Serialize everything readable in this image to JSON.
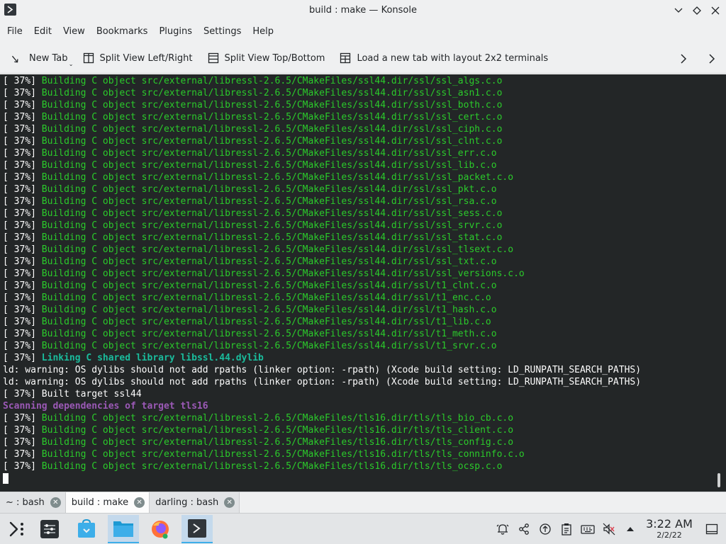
{
  "window": {
    "title": "build : make — Konsole"
  },
  "menu": [
    "File",
    "Edit",
    "View",
    "Bookmarks",
    "Plugins",
    "Settings",
    "Help"
  ],
  "toolbar": {
    "new_tab": "New Tab",
    "split_lr": "Split View Left/Right",
    "split_tb": "Split View Top/Bottom",
    "layout": "Load a new tab with layout 2x2 terminals"
  },
  "terminal": {
    "lines": [
      {
        "pct": "[ 37%]",
        "text": "Building C object src/external/libressl-2.6.5/CMakeFiles/ssl44.dir/ssl/ssl_algs.c.o",
        "style": "green"
      },
      {
        "pct": "[ 37%]",
        "text": "Building C object src/external/libressl-2.6.5/CMakeFiles/ssl44.dir/ssl/ssl_asn1.c.o",
        "style": "green"
      },
      {
        "pct": "[ 37%]",
        "text": "Building C object src/external/libressl-2.6.5/CMakeFiles/ssl44.dir/ssl/ssl_both.c.o",
        "style": "green"
      },
      {
        "pct": "[ 37%]",
        "text": "Building C object src/external/libressl-2.6.5/CMakeFiles/ssl44.dir/ssl/ssl_cert.c.o",
        "style": "green"
      },
      {
        "pct": "[ 37%]",
        "text": "Building C object src/external/libressl-2.6.5/CMakeFiles/ssl44.dir/ssl/ssl_ciph.c.o",
        "style": "green"
      },
      {
        "pct": "[ 37%]",
        "text": "Building C object src/external/libressl-2.6.5/CMakeFiles/ssl44.dir/ssl/ssl_clnt.c.o",
        "style": "green"
      },
      {
        "pct": "[ 37%]",
        "text": "Building C object src/external/libressl-2.6.5/CMakeFiles/ssl44.dir/ssl/ssl_err.c.o",
        "style": "green"
      },
      {
        "pct": "[ 37%]",
        "text": "Building C object src/external/libressl-2.6.5/CMakeFiles/ssl44.dir/ssl/ssl_lib.c.o",
        "style": "green"
      },
      {
        "pct": "[ 37%]",
        "text": "Building C object src/external/libressl-2.6.5/CMakeFiles/ssl44.dir/ssl/ssl_packet.c.o",
        "style": "green"
      },
      {
        "pct": "[ 37%]",
        "text": "Building C object src/external/libressl-2.6.5/CMakeFiles/ssl44.dir/ssl/ssl_pkt.c.o",
        "style": "green"
      },
      {
        "pct": "[ 37%]",
        "text": "Building C object src/external/libressl-2.6.5/CMakeFiles/ssl44.dir/ssl/ssl_rsa.c.o",
        "style": "green"
      },
      {
        "pct": "[ 37%]",
        "text": "Building C object src/external/libressl-2.6.5/CMakeFiles/ssl44.dir/ssl/ssl_sess.c.o",
        "style": "green"
      },
      {
        "pct": "[ 37%]",
        "text": "Building C object src/external/libressl-2.6.5/CMakeFiles/ssl44.dir/ssl/ssl_srvr.c.o",
        "style": "green"
      },
      {
        "pct": "[ 37%]",
        "text": "Building C object src/external/libressl-2.6.5/CMakeFiles/ssl44.dir/ssl/ssl_stat.c.o",
        "style": "green"
      },
      {
        "pct": "[ 37%]",
        "text": "Building C object src/external/libressl-2.6.5/CMakeFiles/ssl44.dir/ssl/ssl_tlsext.c.o",
        "style": "green"
      },
      {
        "pct": "[ 37%]",
        "text": "Building C object src/external/libressl-2.6.5/CMakeFiles/ssl44.dir/ssl/ssl_txt.c.o",
        "style": "green"
      },
      {
        "pct": "[ 37%]",
        "text": "Building C object src/external/libressl-2.6.5/CMakeFiles/ssl44.dir/ssl/ssl_versions.c.o",
        "style": "green"
      },
      {
        "pct": "[ 37%]",
        "text": "Building C object src/external/libressl-2.6.5/CMakeFiles/ssl44.dir/ssl/t1_clnt.c.o",
        "style": "green"
      },
      {
        "pct": "[ 37%]",
        "text": "Building C object src/external/libressl-2.6.5/CMakeFiles/ssl44.dir/ssl/t1_enc.c.o",
        "style": "green"
      },
      {
        "pct": "[ 37%]",
        "text": "Building C object src/external/libressl-2.6.5/CMakeFiles/ssl44.dir/ssl/t1_hash.c.o",
        "style": "green"
      },
      {
        "pct": "[ 37%]",
        "text": "Building C object src/external/libressl-2.6.5/CMakeFiles/ssl44.dir/ssl/t1_lib.c.o",
        "style": "green"
      },
      {
        "pct": "[ 37%]",
        "text": "Building C object src/external/libressl-2.6.5/CMakeFiles/ssl44.dir/ssl/t1_meth.c.o",
        "style": "green"
      },
      {
        "pct": "[ 37%]",
        "text": "Building C object src/external/libressl-2.6.5/CMakeFiles/ssl44.dir/ssl/t1_srvr.c.o",
        "style": "green"
      },
      {
        "pct": "[ 37%]",
        "text": "Linking C shared library libssl.44.dylib",
        "style": "cyan"
      },
      {
        "pct": "",
        "text": "ld: warning: OS dylibs should not add rpaths (linker option: -rpath) (Xcode build setting: LD_RUNPATH_SEARCH_PATHS)",
        "style": "white"
      },
      {
        "pct": "",
        "text": "ld: warning: OS dylibs should not add rpaths (linker option: -rpath) (Xcode build setting: LD_RUNPATH_SEARCH_PATHS)",
        "style": "white"
      },
      {
        "pct": "[ 37%]",
        "text": "Built target ssl44",
        "style": "white"
      },
      {
        "pct": "",
        "text": "Scanning dependencies of target tls16",
        "style": "magenta"
      },
      {
        "pct": "[ 37%]",
        "text": "Building C object src/external/libressl-2.6.5/CMakeFiles/tls16.dir/tls/tls_bio_cb.c.o",
        "style": "green"
      },
      {
        "pct": "[ 37%]",
        "text": "Building C object src/external/libressl-2.6.5/CMakeFiles/tls16.dir/tls/tls_client.c.o",
        "style": "green"
      },
      {
        "pct": "[ 37%]",
        "text": "Building C object src/external/libressl-2.6.5/CMakeFiles/tls16.dir/tls/tls_config.c.o",
        "style": "green"
      },
      {
        "pct": "[ 37%]",
        "text": "Building C object src/external/libressl-2.6.5/CMakeFiles/tls16.dir/tls/tls_conninfo.c.o",
        "style": "green"
      },
      {
        "pct": "[ 37%]",
        "text": "Building C object src/external/libressl-2.6.5/CMakeFiles/tls16.dir/tls/tls_ocsp.c.o",
        "style": "green"
      }
    ]
  },
  "tabs": [
    {
      "label": "~ : bash",
      "active": false
    },
    {
      "label": "build : make",
      "active": true
    },
    {
      "label": "darling : bash",
      "active": false
    }
  ],
  "taskbar": {
    "launchers": [
      "application-launcher-icon",
      "system-settings-icon",
      "discover-icon",
      "file-manager-icon",
      "firefox-icon",
      "konsole-icon"
    ]
  },
  "clock": {
    "time": "3:22 AM",
    "date": "2/2/22"
  },
  "colors": {
    "terminal_bg": "#232627",
    "build_green": "#2bca2b",
    "link_cyan": "#1abc9c",
    "scan_magenta": "#9b59b6",
    "accent": "#3daee9"
  }
}
